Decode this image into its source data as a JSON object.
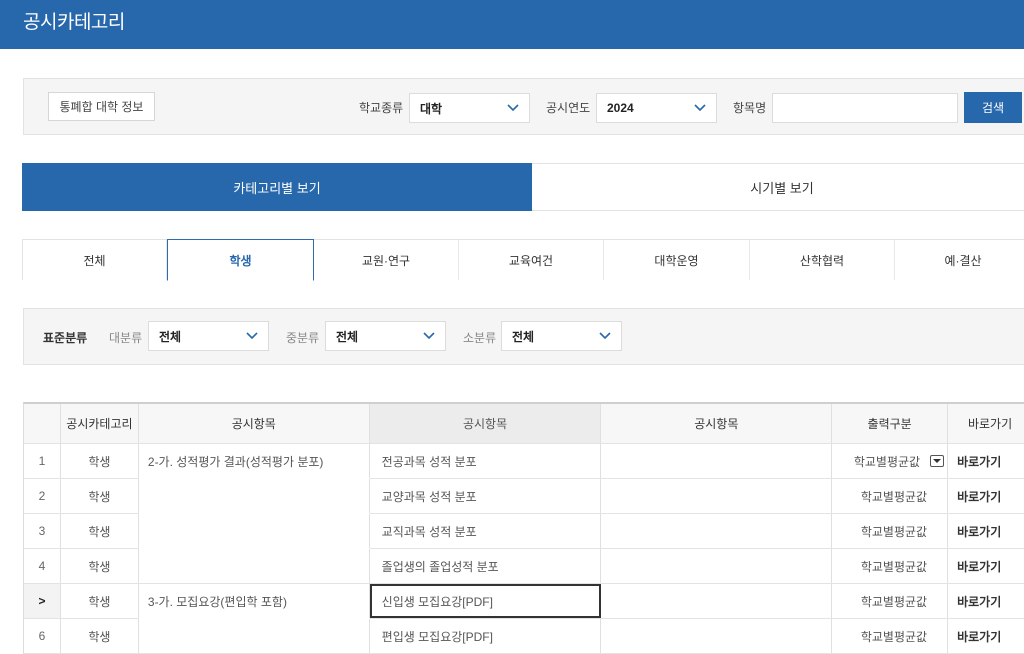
{
  "header": {
    "title": "공시카테고리"
  },
  "search": {
    "info_button": "통폐합 대학 정보",
    "school_type_label": "학교종류",
    "school_type_value": "대학",
    "year_label": "공시연도",
    "year_value": "2024",
    "item_name_label": "항목명",
    "item_name_value": "",
    "item_name_placeholder": "",
    "search_button": "검색"
  },
  "view_tabs": [
    {
      "label": "카테고리별 보기",
      "active": true
    },
    {
      "label": "시기별 보기",
      "active": false
    }
  ],
  "category_tabs": [
    {
      "label": "전체",
      "active": false
    },
    {
      "label": "학생",
      "active": true
    },
    {
      "label": "교원·연구",
      "active": false
    },
    {
      "label": "교육여건",
      "active": false
    },
    {
      "label": "대학운영",
      "active": false
    },
    {
      "label": "산학협력",
      "active": false
    },
    {
      "label": "예·결산",
      "active": false
    }
  ],
  "filter": {
    "title": "표준분류",
    "major_label": "대분류",
    "major_value": "전체",
    "middle_label": "중분류",
    "middle_value": "전체",
    "minor_label": "소분류",
    "minor_value": "전체"
  },
  "table": {
    "columns": [
      "",
      "공시카테고리",
      "공시항목",
      "공시항목",
      "공시항목",
      "출력구분",
      "바로가기"
    ],
    "rows": [
      {
        "num": "1",
        "category": "학생",
        "item": "2-가. 성적평가 결과(성적평가 분포)",
        "sub_item": "전공과목 성적 분포",
        "extra": "",
        "output": "학교별평균값",
        "has_dropdown": true,
        "link": "바로가기"
      },
      {
        "num": "2",
        "category": "학생",
        "item": "",
        "sub_item": "교양과목 성적 분포",
        "extra": "",
        "output": "학교별평균값",
        "has_dropdown": false,
        "link": "바로가기"
      },
      {
        "num": "3",
        "category": "학생",
        "item": "",
        "sub_item": "교직과목 성적 분포",
        "extra": "",
        "output": "학교별평균값",
        "has_dropdown": false,
        "link": "바로가기"
      },
      {
        "num": "4",
        "category": "학생",
        "item": "",
        "sub_item": "졸업생의 졸업성적 분포",
        "extra": "",
        "output": "학교별평균값",
        "has_dropdown": false,
        "link": "바로가기"
      },
      {
        "num": ">",
        "category": "학생",
        "item": "3-가. 모집요강(편입학 포함)",
        "sub_item": "신입생 모집요강[PDF]",
        "extra": "",
        "output": "학교별평균값",
        "has_dropdown": false,
        "link": "바로가기",
        "selected": true
      },
      {
        "num": "6",
        "category": "학생",
        "item": "",
        "sub_item": "편입생 모집요강[PDF]",
        "extra": "",
        "output": "학교별평균값",
        "has_dropdown": false,
        "link": "바로가기"
      }
    ]
  }
}
